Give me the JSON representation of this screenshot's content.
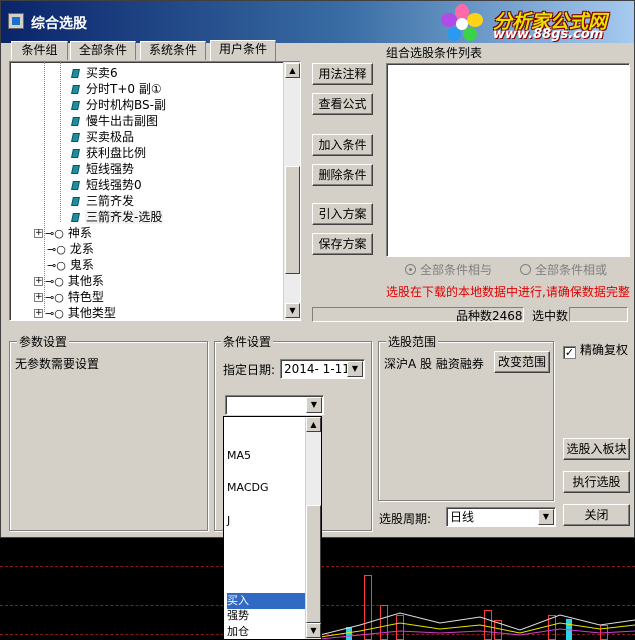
{
  "window": {
    "title": "综合选股",
    "logo_text": "分析家公式网",
    "logo_url": "www.88gs.com"
  },
  "tabs": [
    {
      "label": "条件组"
    },
    {
      "label": "全部条件"
    },
    {
      "label": "系统条件"
    },
    {
      "label": "用户条件",
      "active": true
    }
  ],
  "tree": {
    "leaf_items": [
      {
        "label": "买卖6"
      },
      {
        "label": "分时T+0 副①"
      },
      {
        "label": "分时机构BS-副"
      },
      {
        "label": "慢牛出击副图"
      },
      {
        "label": "买卖极品"
      },
      {
        "label": "获利盘比例"
      },
      {
        "label": "短线强势"
      },
      {
        "label": "短线强势0"
      },
      {
        "label": "三箭齐发"
      },
      {
        "label": "三箭齐发-选股",
        "selected": true
      }
    ],
    "groups": [
      {
        "label": "神系",
        "expandable": true
      },
      {
        "label": "龙系",
        "expandable": false
      },
      {
        "label": "鬼系",
        "expandable": false
      },
      {
        "label": "其他系",
        "expandable": true
      },
      {
        "label": "特色型",
        "expandable": true
      },
      {
        "label": "其他类型",
        "expandable": true
      }
    ]
  },
  "buttons": {
    "usage_notes": "用法注释",
    "view_formula": "查看公式",
    "add_condition": "加入条件",
    "delete_condition": "删除条件",
    "import_scheme": "引入方案",
    "save_scheme": "保存方案",
    "change_range": "改变范围",
    "select_to_block": "选股入板块",
    "execute_selection": "执行选股",
    "close": "关闭"
  },
  "combined": {
    "title": "组合选股条件列表",
    "radio_and": "全部条件相与",
    "radio_or": "全部条件相或"
  },
  "warning": "选股在下载的本地数据中进行,请确保数据完整",
  "stats": {
    "variety_count_label": "品种数",
    "variety_count": "2468",
    "selected_label": "选中数",
    "selected_count": ""
  },
  "params": {
    "title": "参数设置",
    "text": "无参数需要设置"
  },
  "condition_settings": {
    "title": "条件设置",
    "date_label": "指定日期:",
    "date_value": "2014- 1-11",
    "combo_value": ""
  },
  "range": {
    "title": "选股范围",
    "text": "深沪A 股 融资融券"
  },
  "precise_restore": {
    "label": "精确复权",
    "checked": true
  },
  "period": {
    "label": "选股周期:",
    "value": "日线"
  },
  "dropdown": {
    "items": [
      {
        "label": "MA5"
      },
      {
        "label": "MACDG"
      },
      {
        "label": "J"
      },
      {
        "label": "买入",
        "selected": true
      },
      {
        "label": "强势"
      },
      {
        "label": "加仓"
      }
    ]
  }
}
